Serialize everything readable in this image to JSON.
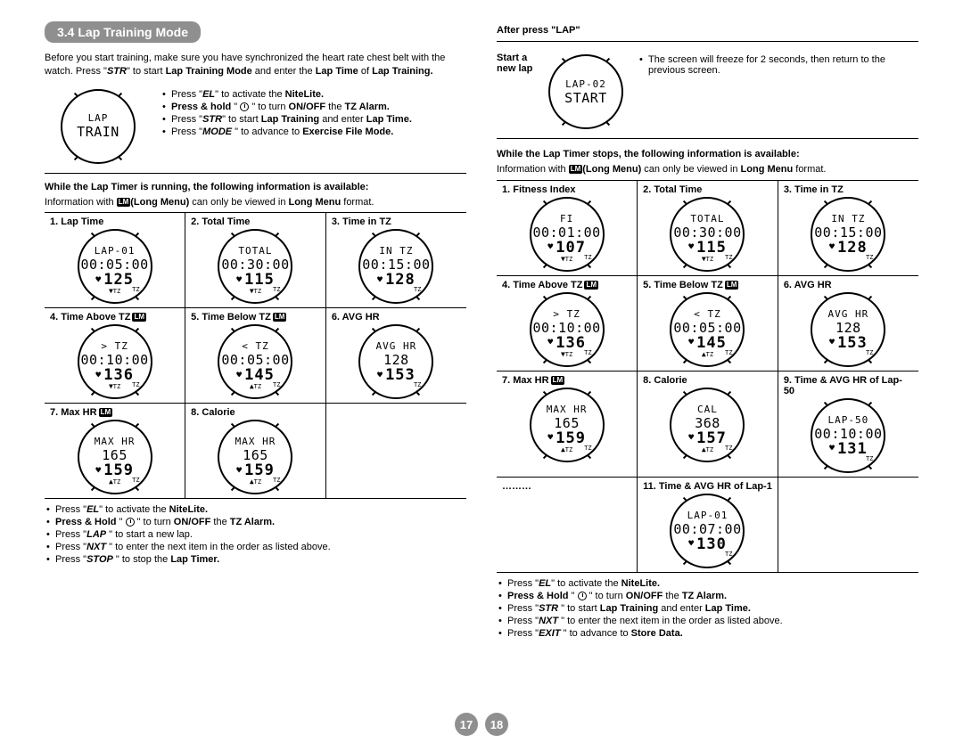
{
  "section_title": "3.4 Lap Training Mode",
  "page_left": "17",
  "page_right": "18",
  "lm_badge": "LM",
  "intro_para": "Before you start training, make sure you have synchronized the heart rate chest belt with the watch. Press \"STR\" to start Lap Training Mode and enter the Lap Time of Lap Training.",
  "intro_watch": {
    "line1": "LAP",
    "line2": "TRAIN"
  },
  "intro_bullets": {
    "i1a": "Press \"",
    "i1b": "EL",
    "i1c": "\" to activate the ",
    "i1d": "NiteLite.",
    "i2a": "Press ",
    "i2b": "& hold",
    "i2c": " \" ",
    "i2d": " \" to turn ",
    "i2e": "ON/OFF",
    "i2f": " the ",
    "i2g": "TZ Alarm.",
    "i3a": "Press \"",
    "i3b": "STR",
    "i3c": "\" to start ",
    "i3d": "Lap Training",
    "i3e": " and enter ",
    "i3f": "Lap Time.",
    "i4a": "Press \"",
    "i4b": "MODE",
    "i4c": " \" to advance to ",
    "i4d": "Exercise File Mode."
  },
  "running_header": "While the Lap Timer is running, the following information is available:",
  "lm_note_a": "Information with ",
  "lm_note_b": "(Long Menu)",
  "lm_note_c": " can only be viewed in ",
  "lm_note_d": "Long Menu",
  "lm_note_e": " format.",
  "left_cells": [
    {
      "title": "1. Lap Time",
      "lm": false,
      "w": {
        "l1": "LAP-01",
        "l2": "00:05:00",
        "l3": "125",
        "heart": true,
        "tz": true,
        "arrow": "down"
      }
    },
    {
      "title": "2. Total Time",
      "lm": false,
      "w": {
        "l1": "TOTAL",
        "l2": "00:30:00",
        "l3": "115",
        "heart": true,
        "tz": true,
        "arrow": "down"
      }
    },
    {
      "title": "3. Time in TZ",
      "lm": false,
      "w": {
        "l1": "IN TZ",
        "l2": "00:15:00",
        "l3": "128",
        "heart": true,
        "tz": true,
        "arrow": ""
      }
    },
    {
      "title": "4. Time Above TZ",
      "lm": true,
      "w": {
        "l1": "> TZ",
        "l2": "00:10:00",
        "l3": "136",
        "heart": true,
        "tz": true,
        "arrow": "down"
      }
    },
    {
      "title": "5. Time Below TZ",
      "lm": true,
      "w": {
        "l1": "< TZ",
        "l2": "00:05:00",
        "l3": "145",
        "heart": true,
        "tz": true,
        "arrow": "up"
      }
    },
    {
      "title": "6. AVG HR",
      "lm": false,
      "w": {
        "l1": "AVG HR",
        "l2": "128",
        "l3": "153",
        "heart": true,
        "tz": true,
        "arrow": ""
      }
    },
    {
      "title": "7. Max HR",
      "lm": true,
      "w": {
        "l1": "MAX HR",
        "l2": "165",
        "l3": "159",
        "heart": true,
        "tz": true,
        "arrow": "up"
      }
    },
    {
      "title": "8. Calorie",
      "lm": false,
      "w": {
        "l1": "MAX HR",
        "l2": "165",
        "l3": "159",
        "heart": true,
        "tz": true,
        "arrow": "up"
      }
    }
  ],
  "left_footer": {
    "f1a": "Press \"",
    "f1b": "EL",
    "f1c": "\" to activate the ",
    "f1d": "NiteLite.",
    "f2a": "Press ",
    "f2b": "& Hold",
    "f2c": " \" ",
    "f2d": " \" to turn ",
    "f2e": "ON/OFF",
    "f2f": " the ",
    "f2g": "TZ Alarm.",
    "f3a": "Press \"",
    "f3b": "LAP",
    "f3c": " \"  to start a new lap.",
    "f4a": "Press \"",
    "f4b": "NXT",
    "f4c": " \" to enter the next item in the order as listed above.",
    "f5a": "Press \"",
    "f5b": "STOP",
    "f5c": " \"  to stop the ",
    "f5d": "Lap Timer."
  },
  "after_press_heading": "After press \"LAP\"",
  "start_lap_label": "Start a new lap",
  "start_lap_watch": {
    "l1": "LAP-02",
    "l2": "START"
  },
  "start_lap_desc": "The screen will freeze for 2 seconds, then return to the previous screen.",
  "stops_header": "While the Lap Timer stops, the following information is available:",
  "right_cells": [
    {
      "title": "1. Fitness Index",
      "lm": false,
      "w": {
        "l1": "FI",
        "l2": "00:01:00",
        "l3": "107",
        "heart": true,
        "tz": true,
        "arrow": "down"
      }
    },
    {
      "title": "2. Total Time",
      "lm": false,
      "w": {
        "l1": "TOTAL",
        "l2": "00:30:00",
        "l3": "115",
        "heart": true,
        "tz": true,
        "arrow": "down"
      }
    },
    {
      "title": "3. Time in TZ",
      "lm": false,
      "w": {
        "l1": "IN TZ",
        "l2": "00:15:00",
        "l3": "128",
        "heart": true,
        "tz": true,
        "arrow": ""
      }
    },
    {
      "title": "4. Time Above TZ",
      "lm": true,
      "w": {
        "l1": "> TZ",
        "l2": "00:10:00",
        "l3": "136",
        "heart": true,
        "tz": true,
        "arrow": "down"
      }
    },
    {
      "title": "5. Time Below TZ",
      "lm": true,
      "w": {
        "l1": "< TZ",
        "l2": "00:05:00",
        "l3": "145",
        "heart": true,
        "tz": true,
        "arrow": "up"
      }
    },
    {
      "title": "6. AVG HR",
      "lm": false,
      "w": {
        "l1": "AVG HR",
        "l2": "128",
        "l3": "153",
        "heart": true,
        "tz": true,
        "arrow": ""
      }
    },
    {
      "title": "7. Max HR",
      "lm": true,
      "w": {
        "l1": "MAX HR",
        "l2": "165",
        "l3": "159",
        "heart": true,
        "tz": true,
        "arrow": "up"
      }
    },
    {
      "title": "8. Calorie",
      "lm": false,
      "w": {
        "l1": "CAL",
        "l2": "368",
        "l3": "157",
        "heart": true,
        "tz": true,
        "arrow": "up"
      }
    },
    {
      "title": "9. Time & AVG HR of Lap-50",
      "lm": false,
      "w": {
        "l1": "LAP-50",
        "l2": "00:10:00",
        "l3": "131",
        "heart": true,
        "tz": true,
        "arrow": ""
      }
    },
    {
      "title": "………",
      "lm": false,
      "w": null
    },
    {
      "title": "11. Time & AVG HR of Lap-1",
      "lm": false,
      "w": {
        "l1": "LAP-01",
        "l2": "00:07:00",
        "l3": "130",
        "heart": true,
        "tz": true,
        "arrow": ""
      }
    }
  ],
  "right_footer": {
    "f1a": "Press \"",
    "f1b": "EL",
    "f1c": "\" to activate the ",
    "f1d": "NiteLite.",
    "f2a": "Press ",
    "f2b": "& Hold",
    "f2c": " \" ",
    "f2d": " \" to turn ",
    "f2e": "ON/OFF",
    "f2f": " the ",
    "f2g": "TZ Alarm.",
    "f3a": "Press \"",
    "f3b": "STR",
    "f3c": " \"  to start ",
    "f3d": "Lap Training",
    "f3e": " and enter ",
    "f3f": "Lap Time.",
    "f4a": "Press \"",
    "f4b": "NXT",
    "f4c": " \" to enter the next item in the order as listed above.",
    "f5a": "Press \"",
    "f5b": "EXIT",
    "f5c": " \"  to advance to ",
    "f5d": "Store Data."
  }
}
